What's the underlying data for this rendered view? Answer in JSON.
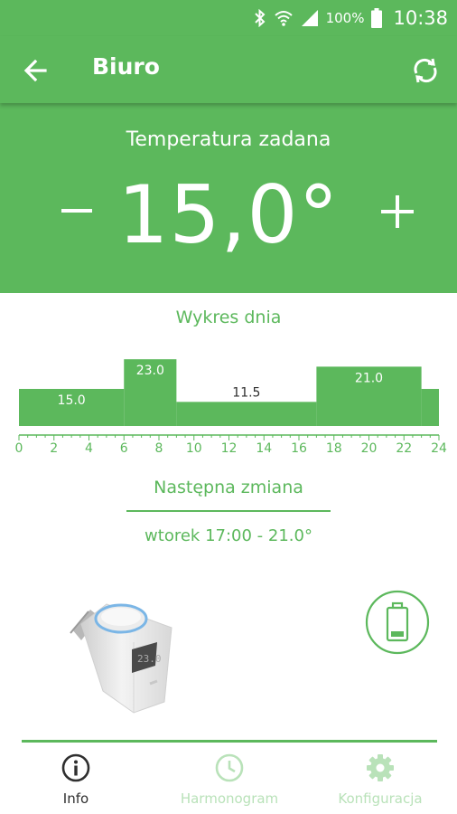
{
  "status_bar": {
    "battery_percent": "100%",
    "time": "10:38",
    "icons": [
      "bluetooth-icon",
      "wifi-icon",
      "cell-signal-icon",
      "battery-icon"
    ]
  },
  "app_bar": {
    "title": "Biuro",
    "back_icon": "arrow-left-icon",
    "sync_icon": "sync-icon"
  },
  "setpoint": {
    "label": "Temperatura zadana",
    "value": "15,0°",
    "minus_label": "−",
    "plus_label": "+"
  },
  "day_chart": {
    "title": "Wykres dnia",
    "hours_range": [
      0,
      24
    ],
    "tick_labels": [
      "0",
      "2",
      "4",
      "6",
      "8",
      "10",
      "12",
      "14",
      "16",
      "18",
      "20",
      "22",
      "24"
    ],
    "segments": [
      {
        "from": 0,
        "to": 6,
        "temp": 15.0,
        "label": "15.0"
      },
      {
        "from": 6,
        "to": 9,
        "temp": 23.0,
        "label": "23.0"
      },
      {
        "from": 9,
        "to": 17,
        "temp": 11.5,
        "label": "11.5"
      },
      {
        "from": 17,
        "to": 23,
        "temp": 21.0,
        "label": "21.0"
      },
      {
        "from": 23,
        "to": 24,
        "temp": 15.0,
        "label": ""
      }
    ],
    "color": "#5cb85c"
  },
  "next_change": {
    "title": "Następna zmiana",
    "value": "wtorek 17:00 - 21.0°"
  },
  "device": {
    "display_text": "23.0",
    "battery_icon": "battery-low-icon"
  },
  "bottom_nav": {
    "items": [
      {
        "label": "Info",
        "icon": "info-icon",
        "active": true
      },
      {
        "label": "Harmonogram",
        "icon": "clock-icon",
        "active": false
      },
      {
        "label": "Konfiguracja",
        "icon": "gear-icon",
        "active": false
      }
    ]
  },
  "colors": {
    "primary": "#5cb85c",
    "inactive_nav": "#b9e2b9",
    "active_nav": "#2f2f2f"
  }
}
